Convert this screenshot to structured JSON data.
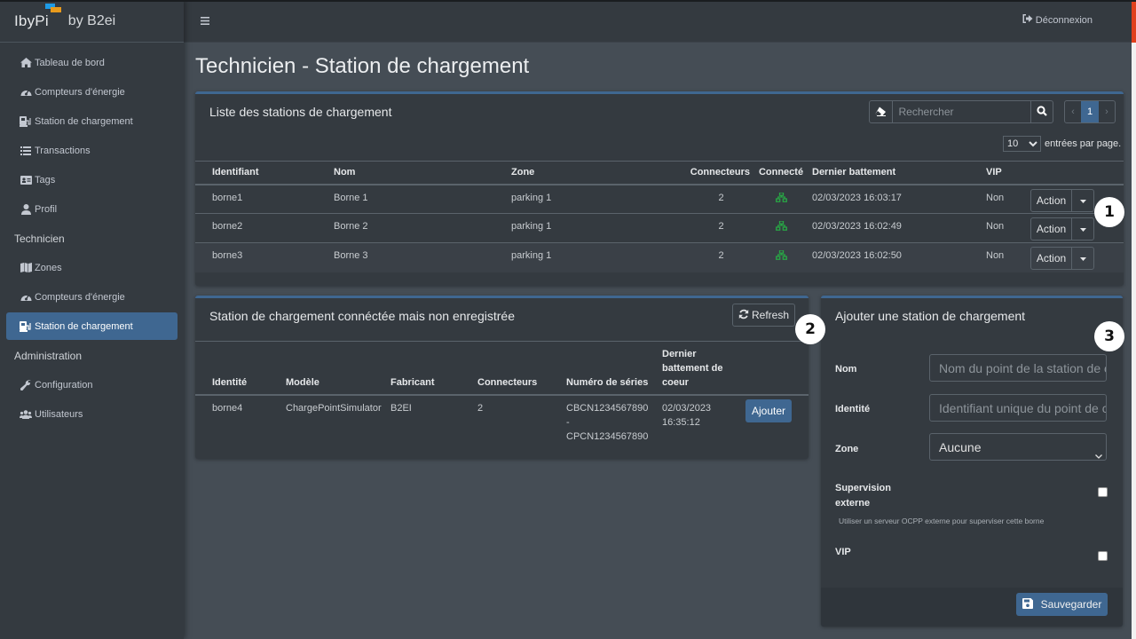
{
  "brand": {
    "logo": "IbyPi",
    "suffix": "by B2ei",
    "logo_colors": [
      "#1e9be6",
      "#e89a1c"
    ]
  },
  "sidebar": {
    "items": [
      {
        "label": "Tableau de bord",
        "icon": "home-icon"
      },
      {
        "label": "Compteurs d'énergie",
        "icon": "gauge-icon"
      },
      {
        "label": "Station de chargement",
        "icon": "charging-station-icon"
      },
      {
        "label": "Transactions",
        "icon": "list-icon"
      },
      {
        "label": "Tags",
        "icon": "id-card-icon"
      },
      {
        "label": "Profil",
        "icon": "user-icon"
      }
    ],
    "technicien_header": "Technicien",
    "technicien_items": [
      {
        "label": "Zones",
        "icon": "map-icon"
      },
      {
        "label": "Compteurs d'énergie",
        "icon": "gauge-icon"
      },
      {
        "label": "Station de chargement",
        "icon": "charging-station-icon",
        "active": true
      }
    ],
    "admin_header": "Administration",
    "admin_items": [
      {
        "label": "Configuration",
        "icon": "wrench-icon"
      },
      {
        "label": "Utilisateurs",
        "icon": "users-icon"
      }
    ]
  },
  "navbar": {
    "logout": "Déconnexion"
  },
  "page_title": "Technicien - Station de chargement",
  "stations_list": {
    "title": "Liste des stations de chargement",
    "search_placeholder": "Rechercher",
    "pagination": {
      "prev": "‹",
      "current": "1",
      "next": "›"
    },
    "per_page_value": "10",
    "per_page_label": "entrées par page.",
    "columns": [
      "Identifiant",
      "Nom",
      "Zone",
      "Connecteurs",
      "Connecté",
      "Dernier battement",
      "VIP"
    ],
    "rows": [
      {
        "id": "borne1",
        "nom": "Borne 1",
        "zone": "parking 1",
        "connecteurs": "2",
        "connecte": true,
        "dernier": "02/03/2023 16:03:17",
        "vip": "Non",
        "action": "Action"
      },
      {
        "id": "borne2",
        "nom": "Borne 2",
        "zone": "parking 1",
        "connecteurs": "2",
        "connecte": true,
        "dernier": "02/03/2023 16:02:49",
        "vip": "Non",
        "action": "Action"
      },
      {
        "id": "borne3",
        "nom": "Borne 3",
        "zone": "parking 1",
        "connecteurs": "2",
        "connecte": true,
        "dernier": "02/03/2023 16:02:50",
        "vip": "Non",
        "action": "Action"
      }
    ],
    "connected_color": "#28a745"
  },
  "unregistered": {
    "title": "Station de chargement connéctée mais non enregistrée",
    "refresh": "Refresh",
    "columns": [
      "Identité",
      "Modèle",
      "Fabricant",
      "Connecteurs",
      "Numéro de séries",
      "Dernier battement de coeur"
    ],
    "rows": [
      {
        "identite": "borne4",
        "modele": "ChargePointSimulator",
        "fabricant": "B2EI",
        "connecteurs": "2",
        "serie_1": "CBCN1234567890",
        "serie_sep": "-",
        "serie_2": "CPCN1234567890",
        "date": "02/03/2023",
        "time": "16:35:12",
        "action": "Ajouter"
      }
    ]
  },
  "add_station": {
    "title": "Ajouter une station de chargement",
    "nom_label": "Nom",
    "nom_placeholder": "Nom du point de la station de chargement",
    "identite_label": "Identité",
    "identite_placeholder": "Identifiant unique du point de charge",
    "zone_label": "Zone",
    "zone_value": "Aucune",
    "supervision_label_1": "Supervision",
    "supervision_label_2": "externe",
    "supervision_checked": false,
    "supervision_help": "Utiliser un serveur OCPP externe pour superviser cette borne",
    "vip_label": "VIP",
    "vip_checked": false,
    "save": "Sauvegarder"
  },
  "annotations": [
    "1",
    "2",
    "3"
  ],
  "colors": {
    "accent": "#3f6791",
    "sidebar_bg": "#343a40",
    "content_bg": "#454d55"
  }
}
